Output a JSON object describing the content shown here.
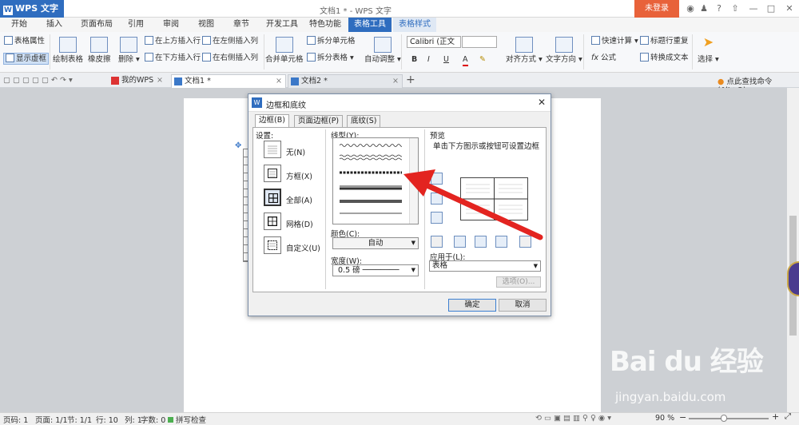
{
  "app": {
    "badge": "WPS 文字",
    "badge_letter": "W",
    "window_title": "文档1 * - WPS 文字",
    "login": "未登录",
    "brand_color": "#2f6dbf",
    "login_color": "#e8623a"
  },
  "menu": [
    "开始",
    "插入",
    "页面布局",
    "引用",
    "审阅",
    "视图",
    "章节",
    "开发工具",
    "特色功能",
    "表格工具",
    "表格样式"
  ],
  "ribbon": {
    "table_props": "表格属性",
    "show_gridlines": "显示虚框",
    "draw_table": "绘制表格",
    "eraser": "橡皮擦",
    "delete": "删除",
    "insert_above": "在上方插入行",
    "insert_below": "在下方插入行",
    "insert_left": "在左侧插入列",
    "insert_right": "在右侧插入列",
    "merge_cells": "合并单元格",
    "split_cells": "拆分单元格",
    "split_table": "拆分表格",
    "autofit": "自动调整",
    "font": "Calibri (正文",
    "bold": "B",
    "italic": "I",
    "underline": "U",
    "font_color": "A",
    "align": "对齐方式",
    "text_dir": "文字方向",
    "quick_calc": "快速计算",
    "formula": "公式",
    "fx": "fx",
    "header_repeat": "标题行重复",
    "to_text": "转换成文本",
    "select": "选择"
  },
  "tabs": [
    {
      "label": "我的WPS"
    },
    {
      "label": "文档1 *"
    },
    {
      "label": "文档2 *"
    }
  ],
  "tab_plus": "+",
  "cmd_search": "点此查找命令 (Alt+Q)",
  "dialog": {
    "title": "边框和底纹",
    "logo": "W",
    "tabs": [
      "边框(B)",
      "页面边框(P)",
      "底纹(S)"
    ],
    "setting_label": "设置:",
    "settings": [
      "无(N)",
      "方框(X)",
      "全部(A)",
      "网格(D)",
      "自定义(U)"
    ],
    "style_label": "线型(Y):",
    "color_label": "颜色(C):",
    "color_value": "自动",
    "width_label": "宽度(W):",
    "width_value": "0.5  磅",
    "preview_label": "预览",
    "preview_hint": "单击下方图示或按钮可设置边框",
    "apply_label": "应用于(L):",
    "apply_value": "表格",
    "options": "选项(O)...",
    "ok": "确定",
    "cancel": "取消"
  },
  "status": {
    "page": "页码: 1",
    "pages": "页面: 1/1",
    "section": "节: 1/1",
    "row": "行: 10",
    "col": "列: 1",
    "words": "字数: 0",
    "spell": "拼写检查",
    "zoom": "90 %",
    "zoom_level": 0.45
  },
  "watermark": {
    "main": "Bai du 经验",
    "sub": "jingyan.baidu.com"
  }
}
